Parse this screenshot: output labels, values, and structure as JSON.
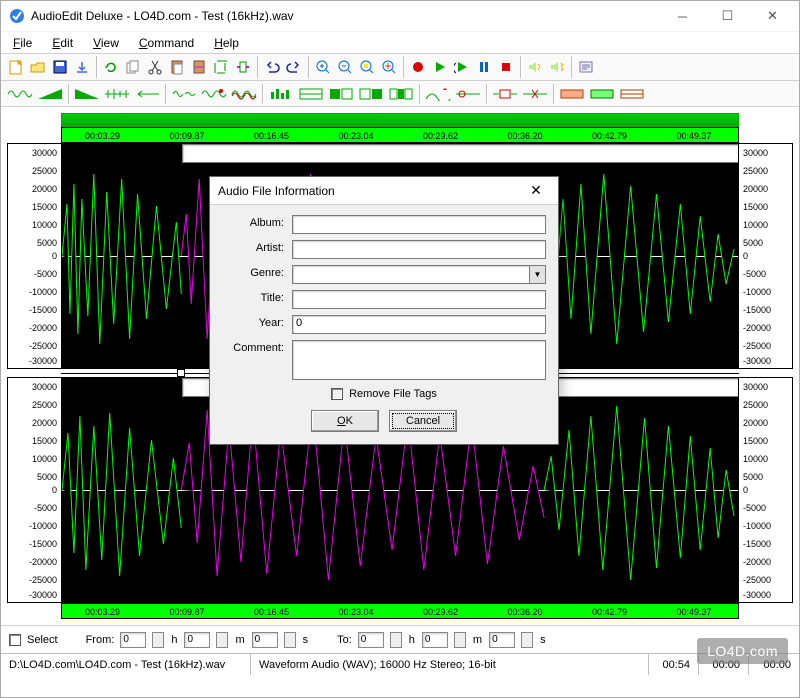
{
  "window": {
    "title": "AudioEdit Deluxe  -  LO4D.com - Test (16kHz).wav"
  },
  "menu": {
    "file": "File",
    "edit": "Edit",
    "view": "View",
    "command": "Command",
    "help": "Help"
  },
  "ruler": {
    "times": [
      "00:03.29",
      "00:09.87",
      "00:16.45",
      "00:23.04",
      "00:29.62",
      "00:36.20",
      "00:42.79",
      "00:49.37"
    ]
  },
  "yscale": {
    "values": [
      "30000",
      "25000",
      "20000",
      "15000",
      "10000",
      "5000",
      "0",
      "-5000",
      "-10000",
      "-15000",
      "-20000",
      "-25000",
      "-30000"
    ]
  },
  "selectbar": {
    "select": "Select",
    "from": "From:",
    "to": "To:",
    "h": "h",
    "m": "m",
    "s": "s",
    "zero": "0"
  },
  "statusbar": {
    "path": "D:\\LO4D.com\\LO4D.com - Test (16kHz).wav",
    "format": "Waveform Audio (WAV); 16000 Hz Stereo; 16-bit",
    "len": "00:54",
    "sel1": "00:00",
    "sel2": "00:00"
  },
  "dialog": {
    "title": "Audio File Information",
    "album": "Album:",
    "artist": "Artist:",
    "genre": "Genre:",
    "title_f": "Title:",
    "year": "Year:",
    "year_val": "0",
    "comment": "Comment:",
    "remove": "Remove File Tags",
    "ok": "OK",
    "cancel": "Cancel"
  },
  "watermark": "LO4D.com"
}
